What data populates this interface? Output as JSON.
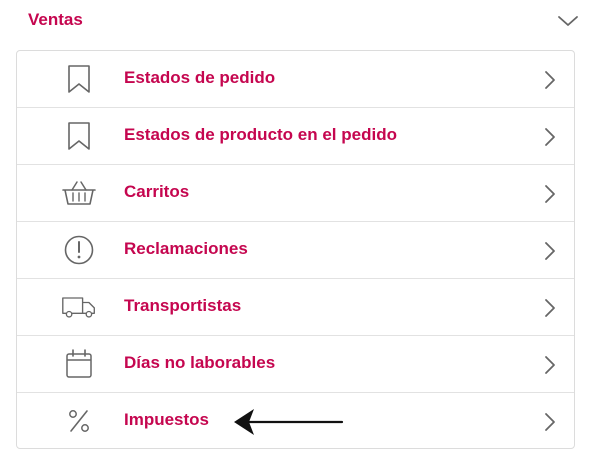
{
  "section": {
    "title": "Ventas",
    "collapse_icon": "chevron-down-icon"
  },
  "colors": {
    "accent": "#c5064f",
    "icon": "#666666",
    "border": "#dcdcdc"
  },
  "menu": {
    "items": [
      {
        "label": "Estados de pedido",
        "icon": "bookmark-icon"
      },
      {
        "label": "Estados de producto en el pedido",
        "icon": "bookmark-icon"
      },
      {
        "label": "Carritos",
        "icon": "basket-icon"
      },
      {
        "label": "Reclamaciones",
        "icon": "alert-circle-icon"
      },
      {
        "label": "Transportistas",
        "icon": "truck-icon"
      },
      {
        "label": "Días no laborables",
        "icon": "calendar-icon"
      },
      {
        "label": "Impuestos",
        "icon": "percent-icon"
      }
    ]
  },
  "annotation": {
    "icon": "arrow-left-icon",
    "points_to": "Impuestos"
  }
}
